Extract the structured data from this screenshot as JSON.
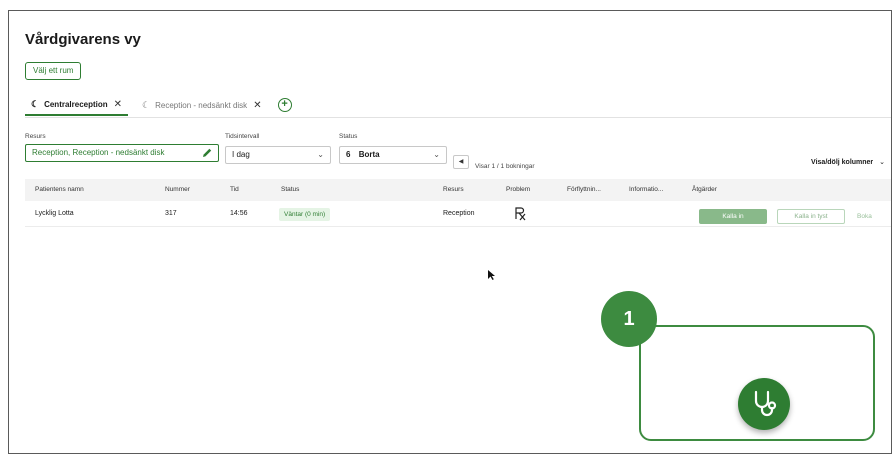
{
  "page": {
    "title": "Vårdgivarens vy"
  },
  "room_button": {
    "label": "Välj ett rum"
  },
  "tabs": [
    {
      "label": "Centralreception",
      "active": true
    },
    {
      "label": "Reception - nedsänkt disk",
      "active": false
    }
  ],
  "filters": {
    "resource": {
      "label": "Resurs",
      "value": "Reception, Reception - nedsänkt disk"
    },
    "interval": {
      "label": "Tidsintervall",
      "value": "I dag"
    },
    "status": {
      "label": "Status",
      "count": "6",
      "value": "Borta"
    },
    "showing": "Visar 1 / 1 bokningar",
    "columns_toggle": "Visa/dölj kolumner"
  },
  "table": {
    "headers": [
      "Patientens namn",
      "Nummer",
      "Tid",
      "Status",
      "Resurs",
      "Problem",
      "Förflyttnin...",
      "Informatio...",
      "Åtgärder"
    ],
    "rows": [
      {
        "name": "Lycklig Lotta",
        "number": "317",
        "time": "14:56",
        "status": "Väntar (0 min)",
        "resource": "Reception",
        "actions": {
          "call": "Kalla in",
          "call_silent": "Kalla in tyst",
          "book": "Boka"
        }
      }
    ]
  },
  "callout": {
    "number": "1"
  },
  "colors": {
    "accent": "#2e7d32",
    "callout": "#3d8b40"
  }
}
